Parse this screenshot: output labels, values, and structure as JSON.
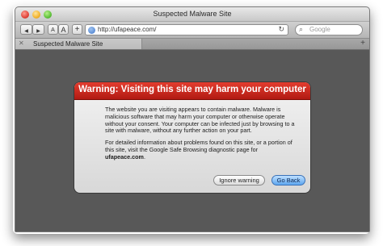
{
  "window": {
    "title": "Suspected Malware Site"
  },
  "toolbar": {
    "back_glyph": "◀",
    "forward_glyph": "▶",
    "text_smaller": "A",
    "text_bigger": "A",
    "add_bookmark": "+",
    "url": "http://ufapeace.com/",
    "reload_glyph": "↻",
    "search_placeholder": "Google"
  },
  "tabbar": {
    "active_tab_label": "Suspected Malware Site",
    "close_glyph": "✕",
    "new_tab_glyph": "+"
  },
  "warning": {
    "title": "Warning: Visiting this site may harm your computer",
    "paragraph1": "The website you are visiting appears to contain malware. Malware is malicious software that may harm your computer or otherwise operate without your consent. Your computer can be infected just by browsing to a site with malware, without any further action on your part.",
    "paragraph2_prefix": "For detailed information about problems found on this site, or a portion of this site, visit the Google Safe Browsing diagnostic page for ",
    "paragraph2_link": "ufapeace.com",
    "paragraph2_suffix": ".",
    "ignore_button": "Ignore warning",
    "back_button": "Go Back"
  }
}
